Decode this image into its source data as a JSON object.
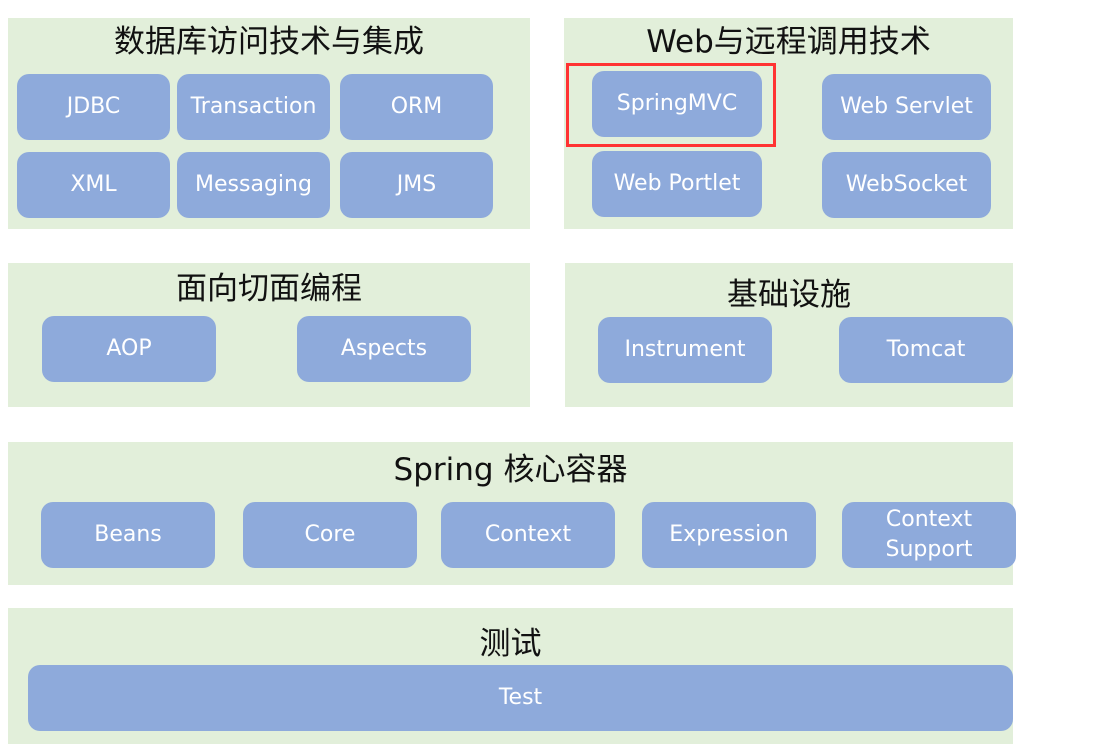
{
  "diagram": {
    "panels": {
      "data_access": {
        "title": "数据库访问技术与集成",
        "modules": [
          "JDBC",
          "Transaction",
          "ORM",
          "XML",
          "Messaging",
          "JMS"
        ]
      },
      "web": {
        "title": "Web与远程调用技术",
        "modules": [
          "SpringMVC",
          "Web Servlet",
          "Web Portlet",
          "WebSocket"
        ],
        "highlighted_module": "SpringMVC",
        "highlight_color": "#ff3333"
      },
      "aop": {
        "title": "面向切面编程",
        "modules": [
          "AOP",
          "Aspects"
        ]
      },
      "infrastructure": {
        "title": "基础设施",
        "modules": [
          "Instrument",
          "Tomcat"
        ]
      },
      "core_container": {
        "title": "Spring 核心容器",
        "modules": [
          "Beans",
          "Core",
          "Context",
          "Expression",
          "Context Support"
        ]
      },
      "test": {
        "title": "测试",
        "modules": [
          "Test"
        ]
      }
    },
    "colors": {
      "panel_background": "#e2efda",
      "module_background": "#8eaadb",
      "module_text": "#ffffff",
      "title_text": "#111111"
    }
  }
}
